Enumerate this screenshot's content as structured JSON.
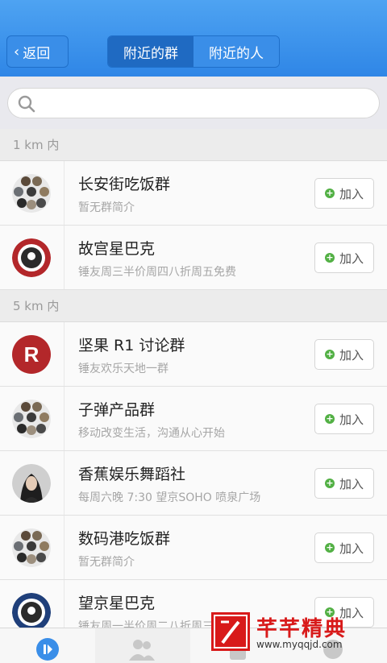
{
  "header": {
    "back_label": "返回",
    "tabs": [
      {
        "label": "附近的群",
        "active": true
      },
      {
        "label": "附近的人",
        "active": false
      }
    ]
  },
  "search": {
    "placeholder": ""
  },
  "sections": [
    {
      "label": "1 km 内",
      "groups": [
        {
          "title": "长安街吃饭群",
          "desc": "暂无群简介",
          "avatar": "collage-avatar",
          "join": "加入"
        },
        {
          "title": "故宫星巴克",
          "desc": "锤友周三半价周四八折周五免费",
          "avatar": "starbucks-avatar",
          "join": "加入"
        }
      ]
    },
    {
      "label": "5 km 内",
      "groups": [
        {
          "title": "坚果 R1 讨论群",
          "desc": "锤友欢乐天地一群",
          "avatar": "r-letter-avatar",
          "avatar_letter": "R",
          "join": "加入"
        },
        {
          "title": "子弹产品群",
          "desc": "移动改变生活，沟通从心开始",
          "avatar": "collage-avatar",
          "join": "加入"
        },
        {
          "title": "香蕉娱乐舞蹈社",
          "desc": "每周六晚 7:30 望京SOHO 喷泉广场",
          "avatar": "portrait-avatar",
          "join": "加入"
        },
        {
          "title": "数码港吃饭群",
          "desc": "暂无群简介",
          "avatar": "collage-avatar",
          "join": "加入"
        },
        {
          "title": "望京星巴克",
          "desc": "锤友周一半价周二八折周三免费",
          "avatar": "starbucks-avatar",
          "join": "加入"
        }
      ]
    }
  ],
  "watermark": {
    "text": "芊芊精典",
    "url": "www.myqqjd.com"
  },
  "colors": {
    "header_blue": "#3a8ee8",
    "join_green": "#52b044",
    "r_avatar": "#b3272a"
  }
}
